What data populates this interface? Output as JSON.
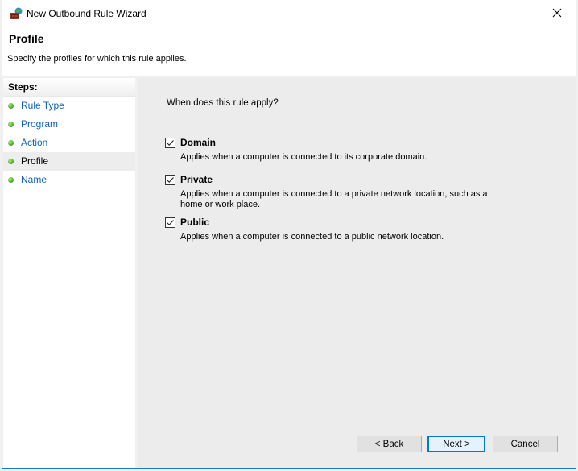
{
  "window": {
    "title": "New Outbound Rule Wizard",
    "icon": "firewall-icon",
    "close_icon": "close-icon"
  },
  "header": {
    "title": "Profile",
    "subtitle": "Specify the profiles for which this rule applies."
  },
  "steps": {
    "heading": "Steps:",
    "items": [
      {
        "label": "Rule Type",
        "current": false
      },
      {
        "label": "Program",
        "current": false
      },
      {
        "label": "Action",
        "current": false
      },
      {
        "label": "Profile",
        "current": true
      },
      {
        "label": "Name",
        "current": false
      }
    ]
  },
  "main": {
    "question": "When does this rule apply?",
    "options": [
      {
        "label": "Domain",
        "checked": true,
        "description": "Applies when a computer is connected to its corporate domain."
      },
      {
        "label": "Private",
        "checked": true,
        "description": "Applies when a computer is connected to a private network location, such as a home or work place."
      },
      {
        "label": "Public",
        "checked": true,
        "description": "Applies when a computer is connected to a public network location."
      }
    ]
  },
  "buttons": {
    "back": "< Back",
    "next": "Next >",
    "cancel": "Cancel"
  },
  "colors": {
    "accent": "#0078d7",
    "link": "#1560bd",
    "window_border": "#1979ca"
  }
}
